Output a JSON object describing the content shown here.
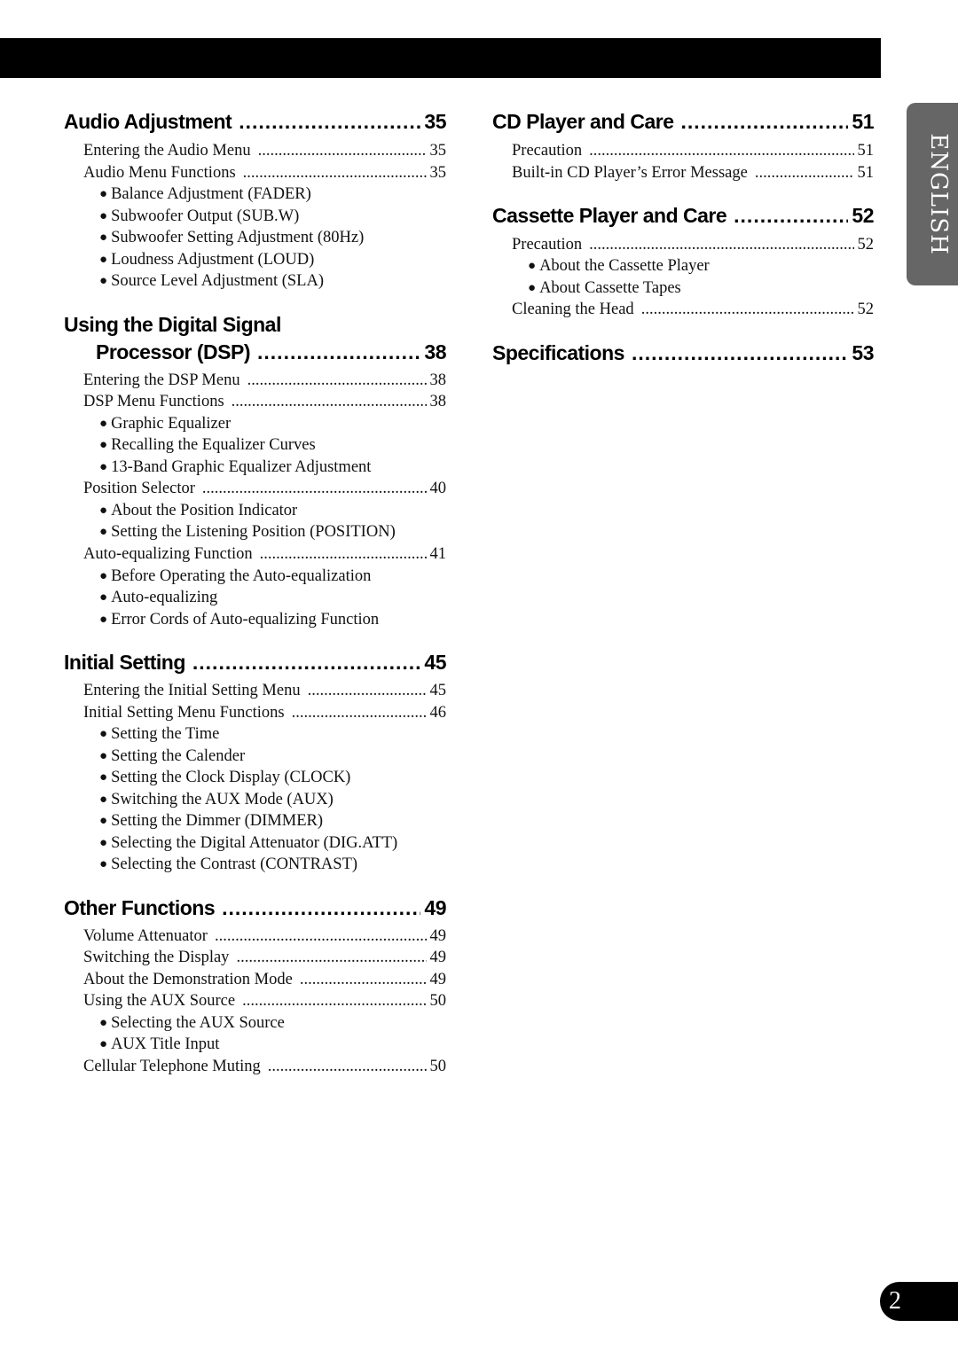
{
  "language_tab": "ENGLISH",
  "page_number": "2",
  "left_column": {
    "audio": {
      "title": "Audio Adjustment",
      "page": "35",
      "items": [
        {
          "label": "Entering the Audio Menu",
          "page": "35"
        },
        {
          "label": "Audio Menu Functions",
          "page": "35"
        }
      ],
      "bullets": [
        "Balance Adjustment (FADER)",
        "Subwoofer Output (SUB.W)",
        "Subwoofer Setting Adjustment (80Hz)",
        "Loudness Adjustment (LOUD)",
        "Source Level Adjustment (SLA)"
      ]
    },
    "dsp": {
      "title_line1": "Using the Digital Signal",
      "title_line2": "Processor (DSP)",
      "page": "38",
      "items": [
        {
          "label": "Entering the DSP Menu",
          "page": "38"
        },
        {
          "label": "DSP Menu Functions",
          "page": "38"
        },
        {
          "label": "Position Selector",
          "page": "40"
        },
        {
          "label": "Auto-equalizing Function",
          "page": "41"
        }
      ],
      "bullets_functions": [
        "Graphic Equalizer",
        "Recalling the Equalizer Curves",
        "13-Band Graphic Equalizer Adjustment"
      ],
      "bullets_position": [
        "About the Position Indicator",
        "Setting the Listening Position (POSITION)"
      ],
      "bullets_auto": [
        "Before Operating the Auto-equalization",
        "Auto-equalizing",
        "Error Cords of Auto-equalizing Function"
      ]
    },
    "initial": {
      "title": "Initial Setting",
      "page": "45",
      "items": [
        {
          "label": "Entering the Initial Setting Menu",
          "page": "45"
        },
        {
          "label": "Initial Setting Menu Functions",
          "page": "46"
        }
      ],
      "bullets": [
        "Setting the Time",
        "Setting the Calender",
        "Setting the Clock Display (CLOCK)",
        "Switching the AUX Mode (AUX)",
        "Setting the Dimmer (DIMMER)",
        "Selecting the Digital Attenuator (DIG.ATT)",
        "Selecting the Contrast (CONTRAST)"
      ]
    },
    "other": {
      "title": "Other Functions",
      "page": "49",
      "items": [
        {
          "label": "Volume Attenuator",
          "page": "49"
        },
        {
          "label": "Switching the Display",
          "page": "49"
        },
        {
          "label": "About the Demonstration Mode",
          "page": "49"
        },
        {
          "label": "Using the AUX Source",
          "page": "50"
        },
        {
          "label": "Cellular Telephone Muting",
          "page": "50"
        }
      ],
      "bullets": [
        "Selecting the AUX Source",
        "AUX Title Input"
      ]
    }
  },
  "right_column": {
    "cd": {
      "title": "CD Player and Care",
      "page": "51",
      "items": [
        {
          "label": "Precaution",
          "page": "51"
        },
        {
          "label": "Built-in CD Player’s Error Message",
          "page": "51"
        }
      ]
    },
    "cassette": {
      "title": "Cassette Player and Care",
      "page": "52",
      "items": [
        {
          "label": "Precaution",
          "page": "52"
        },
        {
          "label": "Cleaning the Head",
          "page": "52"
        }
      ],
      "bullets": [
        "About the Cassette Player",
        "About Cassette Tapes"
      ]
    },
    "specs": {
      "title": "Specifications",
      "page": "53"
    }
  }
}
